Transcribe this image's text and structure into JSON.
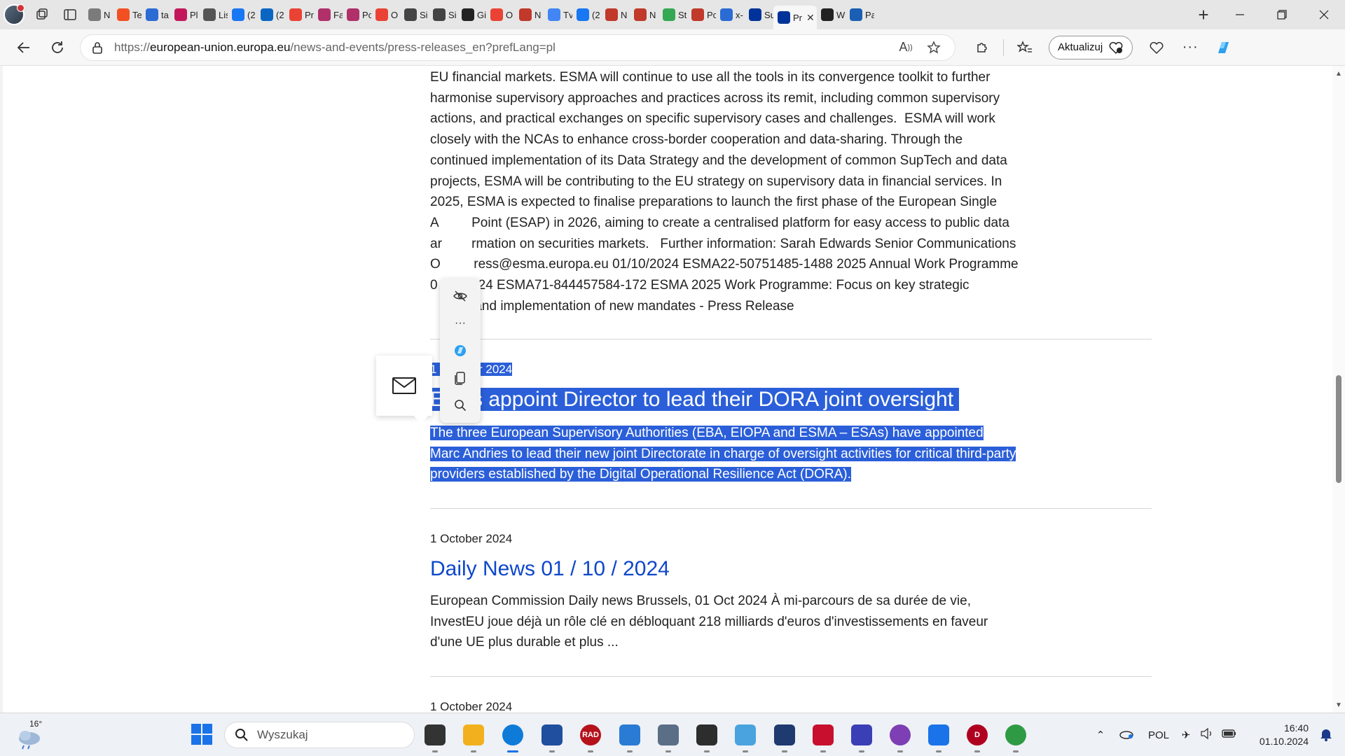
{
  "browser": {
    "tabs": [
      {
        "label": "N",
        "color": "#7b7b7b",
        "icon": "tab-page-icon"
      },
      {
        "label": "Te",
        "color": "#f25022",
        "icon": "microsoft-icon"
      },
      {
        "label": "ta",
        "color": "#2b6cd4",
        "icon": "search-icon"
      },
      {
        "label": "Pl",
        "color": "#c2185b",
        "icon": "app-icon"
      },
      {
        "label": "Lis",
        "color": "#555555",
        "icon": "speaker-icon"
      },
      {
        "label": "(2",
        "color": "#1877f2",
        "icon": "facebook-icon"
      },
      {
        "label": "(2",
        "color": "#0a66c2",
        "icon": "linkedin-icon"
      },
      {
        "label": "Pr",
        "color": "#ea4335",
        "icon": "gmail-icon"
      },
      {
        "label": "Fa",
        "color": "#b0306a",
        "icon": "app-icon"
      },
      {
        "label": "Pc",
        "color": "#b0306a",
        "icon": "app-icon"
      },
      {
        "label": "O",
        "color": "#ea4335",
        "icon": "gmail-icon"
      },
      {
        "label": "Si",
        "color": "#444444",
        "icon": "r-icon"
      },
      {
        "label": "Si",
        "color": "#444444",
        "icon": "r-icon"
      },
      {
        "label": "Gi",
        "color": "#222222",
        "icon": "github-icon"
      },
      {
        "label": "O",
        "color": "#ea4335",
        "icon": "gmail-icon"
      },
      {
        "label": "N",
        "color": "#c0392b",
        "icon": "maps-pin-icon"
      },
      {
        "label": "Tv",
        "color": "#4285f4",
        "icon": "google-icon"
      },
      {
        "label": "(2",
        "color": "#1877f2",
        "icon": "facebook-icon"
      },
      {
        "label": "N",
        "color": "#c0392b",
        "icon": "maps-pin-icon"
      },
      {
        "label": "N",
        "color": "#c0392b",
        "icon": "maps-pin-icon"
      },
      {
        "label": "St",
        "color": "#34a853",
        "icon": "drive-icon"
      },
      {
        "label": "Pc",
        "color": "#c0392b",
        "icon": "maps-pin-icon"
      },
      {
        "label": "x-",
        "color": "#2b6cd4",
        "icon": "search-icon"
      },
      {
        "label": "Su",
        "color": "#003399",
        "icon": "eu-flag-icon"
      },
      {
        "label": "Pr",
        "color": "#003399",
        "icon": "eu-flag-icon",
        "active": true
      },
      {
        "label": "W",
        "color": "#222222",
        "icon": "app-icon"
      },
      {
        "label": "Pa",
        "color": "#1a5fb4",
        "icon": "paypal-icon"
      }
    ],
    "url_prefix": "https://",
    "url_host": "european-union.europa.eu",
    "url_path": "/news-and-events/press-releases_en?prefLang=pl",
    "update_label": "Aktualizuj"
  },
  "article_top": {
    "lines": [
      "EU financial markets. ESMA will continue to use all the tools in its convergence toolkit to further",
      "harmonise supervisory approaches and practices across its remit, including common supervisory",
      "actions, and practical exchanges on specific supervisory cases and challenges.  ESMA will work",
      "closely with the NCAs to enhance cross-border cooperation and data-sharing. Through the",
      "continued implementation of its Data Strategy and the development of common SupTech and data",
      "projects, ESMA will be contributing to the EU strategy on supervisory data in financial services. In",
      "2025, ESMA is expected to finalise preparations to launch the first phase of the European Single",
      "A         Point (ESAP) in 2026, aiming to create a centralised platform for easy access to public data",
      "ar        rmation on securities markets.   Further information: Sarah Edwards Senior Communications",
      "O         ress@esma.europa.eu 01/10/2024 ESMA22-50751485-1488 2025 Annual Work Programme",
      "0         024 ESMA71-844457584-172 ESMA 2025 Work Programme: Focus on key strategic",
      "            and implementation of new mandates - Press Release"
    ]
  },
  "news": [
    {
      "date": "1 October 2024",
      "title": "ESAs appoint Director to lead their DORA joint oversight",
      "body_lines": [
        "The three European Supervisory Authorities (EBA, EIOPA and ESMA – ESAs) have appointed",
        "Marc Andries to lead their new joint Directorate in charge of oversight activities for critical third-party",
        "providers established by the Digital Operational Resilience Act (DORA)."
      ]
    },
    {
      "date": "1 October 2024",
      "title": "Daily News 01 / 10 / 2024",
      "body_lines": [
        "European Commission Daily news Brussels, 01 Oct 2024 À mi-parcours de sa durée de vie,",
        "InvestEU joue déjà un rôle clé en débloquant 218 milliards d'euros d'investissements en faveur",
        "d'une UE plus durable et plus ..."
      ]
    },
    {
      "date": "1 October 2024"
    }
  ],
  "taskbar": {
    "weather_temp": "16°",
    "search_placeholder": "Wyszukaj",
    "apps": [
      {
        "name": "task-view-icon",
        "color": "#333333",
        "label": ""
      },
      {
        "name": "file-explorer-icon",
        "color": "#f2b01e",
        "label": ""
      },
      {
        "name": "edge-icon",
        "color": "#0f7bd8",
        "label": ""
      },
      {
        "name": "store-icon",
        "color": "#1f4f9e",
        "label": ""
      },
      {
        "name": "rad-icon",
        "color": "#b5121b",
        "label": "RAD"
      },
      {
        "name": "notepad-icon",
        "color": "#2a7bd4",
        "label": ""
      },
      {
        "name": "settings-icon",
        "color": "#5a6f86",
        "label": ""
      },
      {
        "name": "terminal-icon",
        "color": "#2d2d2d",
        "label": ""
      },
      {
        "name": "screenshot-icon",
        "color": "#4aa3df",
        "label": ""
      },
      {
        "name": "virtualbox-icon",
        "color": "#1e3a6e",
        "label": ""
      },
      {
        "name": "media-app-icon",
        "color": "#c8102e",
        "label": ""
      },
      {
        "name": "save-disk-icon",
        "color": "#3b3fb5",
        "label": ""
      },
      {
        "name": "tor-icon",
        "color": "#7d3fb3",
        "label": ""
      },
      {
        "name": "shield-app-icon",
        "color": "#1a73e8",
        "label": ""
      },
      {
        "name": "d-app-icon",
        "color": "#b00020",
        "label": "D"
      },
      {
        "name": "globe-app-icon",
        "color": "#2e9b44",
        "label": ""
      }
    ],
    "language": "POL",
    "time": "16:40",
    "date": "01.10.2024"
  }
}
